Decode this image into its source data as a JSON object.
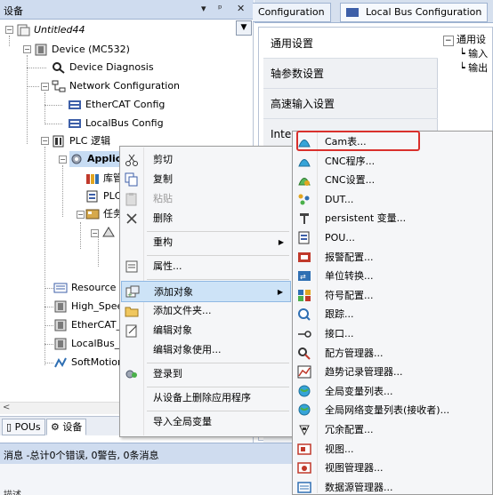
{
  "devices_panel": {
    "title": "设备",
    "pin_label": "▾",
    "pin2_label": "ᵖ",
    "close_label": "✕",
    "tree": [
      {
        "label": "Untitled44",
        "italic": true
      },
      {
        "label": "Device (MC532)"
      },
      {
        "label": "Device Diagnosis"
      },
      {
        "label": "Network Configuration"
      },
      {
        "label": "EtherCAT Config"
      },
      {
        "label": "LocalBus Config"
      },
      {
        "label": "PLC 逻辑"
      },
      {
        "label": "Applica",
        "bold": true
      },
      {
        "label": "库管"
      },
      {
        "label": "PLC"
      },
      {
        "label": "任务"
      },
      {
        "label": "Resource Us"
      },
      {
        "label": "High_Speed"
      },
      {
        "label": "EtherCAT_M"
      },
      {
        "label": "LocalBus_Ma"
      },
      {
        "label": "SoftMotion C"
      }
    ],
    "bottom_tabs": [
      {
        "label": "POUs"
      },
      {
        "label": "设备"
      }
    ]
  },
  "messages": {
    "summary": "消息 -总计0个错误, 0警告, 0条消息",
    "sub": "描述"
  },
  "editor": {
    "tabs": [
      {
        "label": "Configuration"
      },
      {
        "label": "Local Bus Configuration"
      }
    ],
    "side_nav": [
      {
        "label": "通用设置"
      },
      {
        "label": "轴参数设置"
      },
      {
        "label": "高速输入设置"
      },
      {
        "label": "Inter"
      }
    ],
    "general_tree": {
      "root": "通用设",
      "children": [
        "输入",
        "输出"
      ]
    }
  },
  "context_menu": {
    "items": [
      {
        "label": "剪切",
        "icon": "scissors-icon"
      },
      {
        "label": "复制",
        "icon": "copy-icon"
      },
      {
        "label": "粘贴",
        "icon": "paste-icon",
        "disabled": true
      },
      {
        "label": "删除",
        "icon": "delete-icon"
      },
      {
        "label": "重构",
        "icon": "",
        "submenu": true
      },
      {
        "label": "属性...",
        "icon": "properties-icon"
      },
      {
        "label": "添加对象",
        "icon": "add-object-icon",
        "submenu": true,
        "highlighted": true
      },
      {
        "label": "添加文件夹...",
        "icon": "folder-icon"
      },
      {
        "label": "编辑对象",
        "icon": "edit-object-icon"
      },
      {
        "label": "编辑对象使用...",
        "icon": ""
      },
      {
        "label": "登录到",
        "icon": "login-icon"
      },
      {
        "label": "从设备上删除应用程序",
        "icon": ""
      },
      {
        "label": "导入全局变量",
        "icon": ""
      }
    ]
  },
  "submenu": {
    "items": [
      {
        "label": "Cam表...",
        "icon": "cam-table-icon",
        "highlighted": true
      },
      {
        "label": "CNC程序...",
        "icon": "cnc-program-icon"
      },
      {
        "label": "CNC设置...",
        "icon": "cnc-settings-icon"
      },
      {
        "label": "DUT...",
        "icon": "dut-icon"
      },
      {
        "label": "persistent 变量...",
        "icon": "persistent-variable-icon"
      },
      {
        "label": "POU...",
        "icon": "pou-icon"
      },
      {
        "label": "报警配置...",
        "icon": "alarm-config-icon"
      },
      {
        "label": "单位转换...",
        "icon": "unit-conversion-icon"
      },
      {
        "label": "符号配置...",
        "icon": "symbol-config-icon"
      },
      {
        "label": "跟踪...",
        "icon": "trace-icon"
      },
      {
        "label": "接口...",
        "icon": "interface-icon"
      },
      {
        "label": "配方管理器...",
        "icon": "recipe-manager-icon"
      },
      {
        "label": "趋势记录管理器...",
        "icon": "trend-recording-icon"
      },
      {
        "label": "全局变量列表...",
        "icon": "global-variable-list-icon"
      },
      {
        "label": "全局网络变量列表(接收者)...",
        "icon": "network-variable-list-icon"
      },
      {
        "label": "冗余配置...",
        "icon": "redundancy-config-icon"
      },
      {
        "label": "视图...",
        "icon": "visualization-icon"
      },
      {
        "label": "视图管理器...",
        "icon": "visualization-manager-icon"
      },
      {
        "label": "数据源管理器...",
        "icon": "data-source-manager-icon"
      }
    ]
  }
}
